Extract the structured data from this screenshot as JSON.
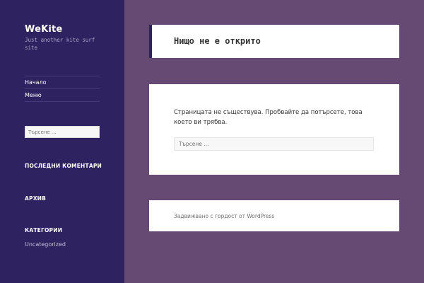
{
  "site": {
    "title": "WeKite",
    "description": "Just another kite surf site"
  },
  "menu": {
    "items": [
      {
        "label": "Начало"
      },
      {
        "label": "Меню"
      }
    ]
  },
  "sidebar_search": {
    "placeholder": "Търсене …"
  },
  "widgets": {
    "recent_comments_title": "ПОСЛЕДНИ КОМЕНТАРИ",
    "archive_title": "АРХИВ",
    "categories_title": "КАТЕГОРИИ",
    "categories": [
      "Uncategorized"
    ]
  },
  "main": {
    "page_title": "Нищо не е открито",
    "message": "Страницата не съществува. Пробвайте да потърсете, това което ви трябва.",
    "search_placeholder": "Търсене …"
  },
  "footer": {
    "text": "Задвижвано с гордост от WordPress"
  },
  "colors": {
    "sidebar_bg": "#2e2260",
    "page_bg": "#674a74",
    "panel_bg": "#ffffff"
  }
}
